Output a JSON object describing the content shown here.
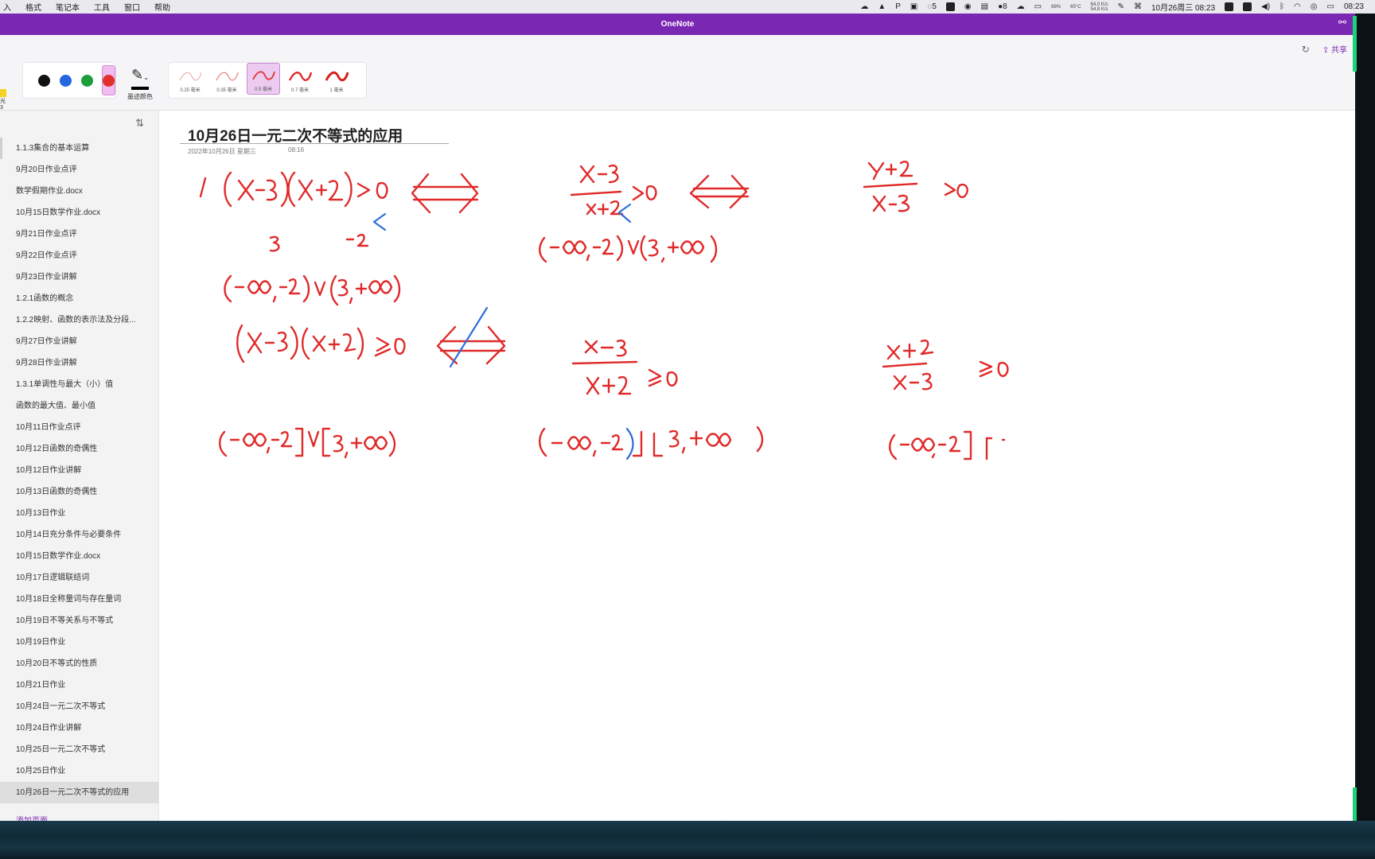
{
  "menubar": {
    "items": [
      "入",
      "格式",
      "笔记本",
      "工具",
      "窗口",
      "帮助"
    ],
    "battery_pct": "68%",
    "temp": "65°C",
    "net_up": "64.0 K/s",
    "net_down": "54.8 K/s",
    "notif_count": "5",
    "qq_count": "8",
    "datetime": "10月26周三 08:23",
    "clock": "08:23"
  },
  "window": {
    "title": "OneNote",
    "share_label": "共享"
  },
  "toolbar": {
    "left_tool_text": "光\n3",
    "colors": [
      {
        "name": "black",
        "hex": "#111111",
        "selected": false
      },
      {
        "name": "blue",
        "hex": "#2366e0",
        "selected": false
      },
      {
        "name": "green",
        "hex": "#1d9e3a",
        "selected": false
      },
      {
        "name": "red",
        "hex": "#e0302a",
        "selected": true
      }
    ],
    "edge_color_label": "墨迹颜色",
    "widths": [
      {
        "label": "0.25 毫米",
        "selected": false
      },
      {
        "label": "0.35 毫米",
        "selected": false
      },
      {
        "label": "0.5 毫米",
        "selected": true
      },
      {
        "label": "0.7 毫米",
        "selected": false
      },
      {
        "label": "1 毫米",
        "selected": false
      }
    ]
  },
  "sidebar": {
    "pages": [
      "1.1.3集合的基本运算",
      "9月20日作业点评",
      "数学假期作业.docx",
      "10月15日数学作业.docx",
      "9月21日作业点评",
      "9月22日作业点评",
      "9月23日作业讲解",
      "1.2.1函数的概念",
      "1.2.2映射、函数的表示法及分段...",
      "9月27日作业讲解",
      "9月28日作业讲解",
      "1.3.1单调性与最大（小）值",
      "函数的最大值、最小值",
      "10月11日作业点评",
      "10月12日函数的奇偶性",
      "10月12日作业讲解",
      "10月13日函数的奇偶性",
      "10月13日作业",
      "10月14日充分条件与必要条件",
      "10月15日数学作业.docx",
      "10月17日逻辑联结词",
      "10月18日全称量词与存在量词",
      "10月19日不等关系与不等式",
      "10月19日作业",
      "10月20日不等式的性质",
      "10月21日作业",
      "10月24日一元二次不等式",
      "10月24日作业讲解",
      "10月25日一元二次不等式",
      "10月25日作业",
      "10月26日一元二次不等式的应用"
    ],
    "active_index": 30,
    "add_page": "添加页面"
  },
  "note": {
    "title": "10月26日一元二次不等式的应用",
    "date": "2022年10月26日 星期三",
    "time": "08:16"
  },
  "ink": {
    "red": "#e02a2a",
    "blue": "#2f6fd8",
    "row1": {
      "lhs": "(X-3)(X+2)>0",
      "mid": "(x-3)/(x+2)>0",
      "rhs": "(x+2)/(x-3)>0",
      "roots": [
        "3",
        "-2"
      ],
      "sol1": "(-∞,-2)∪(3,+∞)",
      "sol2": "(-∞,-2)∪(3,+∞)"
    },
    "row2": {
      "lhs": "(X-3)(X+2)≥0",
      "mid": "(x-3)/(x+2)≥0",
      "rhs": "(x+2)/(x-3)≥0",
      "sol1": "(-∞,-2]∪[3,+∞)",
      "sol2": "(-∞,-2)∪[3,+∞)",
      "sol3": "(-∞,-2]∪"
    }
  }
}
